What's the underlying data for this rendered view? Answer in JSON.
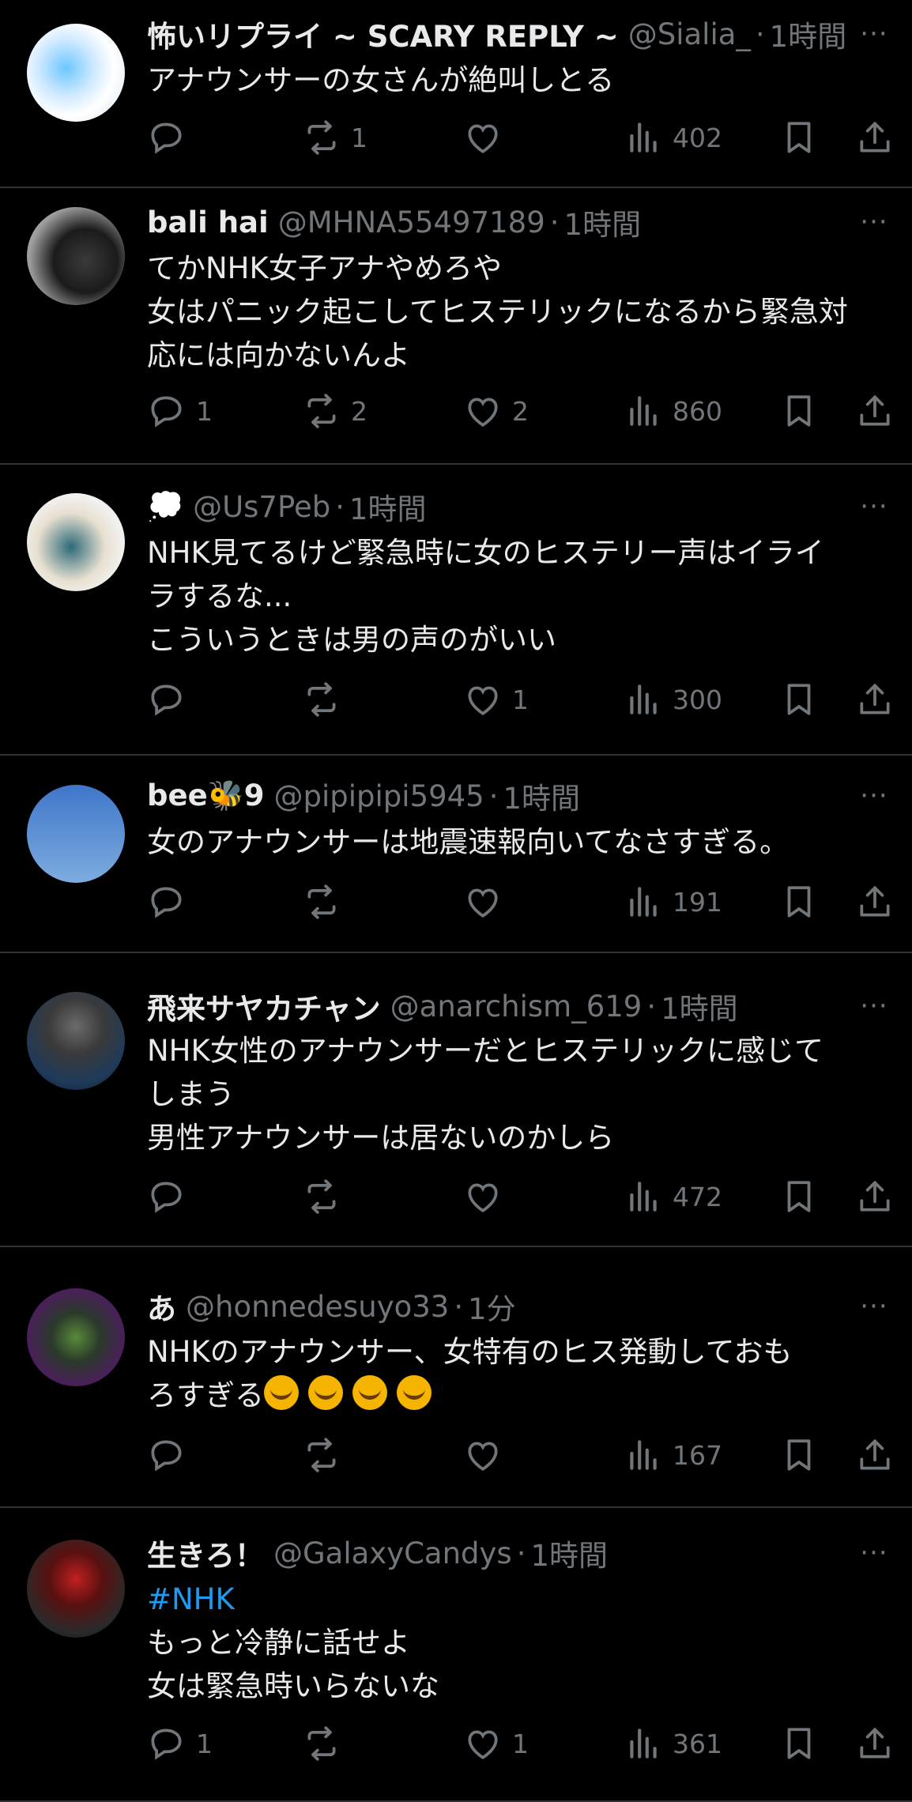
{
  "tweets": [
    {
      "name": "怖いリプライ ~ SCARY REPLY ~",
      "handle": "@Sialia_",
      "time": "1時間",
      "lines": [
        "アナウンサーの女さんが絶叫しとる"
      ],
      "replies": "",
      "retweets": "1",
      "likes": "",
      "views": "402"
    },
    {
      "name": "bali hai",
      "handle": "@MHNA55497189",
      "time": "1時間",
      "lines": [
        "てかNHK女子アナやめろや",
        "女はパニック起こしてヒステリックになるから緊急対",
        "応には向かないんよ"
      ],
      "replies": "1",
      "retweets": "2",
      "likes": "2",
      "views": "860"
    },
    {
      "name": "💭",
      "handle": "@Us7Peb",
      "time": "1時間",
      "lines": [
        "NHK見てるけど緊急時に女のヒステリー声はイライ",
        "ラするな...",
        "こういうときは男の声のがいい"
      ],
      "replies": "",
      "retweets": "",
      "likes": "1",
      "views": "300"
    },
    {
      "name": "bee🐝9",
      "handle": "@pipipipi5945",
      "time": "1時間",
      "lines": [
        "女のアナウンサーは地震速報向いてなさすぎる。"
      ],
      "replies": "",
      "retweets": "",
      "likes": "",
      "views": "191"
    },
    {
      "name": "飛来サヤカチャン",
      "handle": "@anarchism_619",
      "time": "1時間",
      "lines": [
        "NHK女性のアナウンサーだとヒステリックに感じて",
        "しまう",
        "男性アナウンサーは居ないのかしら"
      ],
      "replies": "",
      "retweets": "",
      "likes": "",
      "views": "472"
    },
    {
      "name": "あ",
      "handle": "@honnedesuyo33",
      "time": "1分",
      "lines": [
        "NHKのアナウンサー、女特有のヒス発動しておも",
        "ろすぎる"
      ],
      "emoji_count": 4,
      "replies": "",
      "retweets": "",
      "likes": "",
      "views": "167"
    },
    {
      "name": "生きろ！",
      "handle": "@GalaxyCandys",
      "time": "1時間",
      "hashtag": "#NHK",
      "lines": [
        "もっと冷静に話せよ",
        "女は緊急時いらないな"
      ],
      "replies": "1",
      "retweets": "",
      "likes": "1",
      "views": "361"
    }
  ],
  "ui": {
    "more_label": "···",
    "dot": "·"
  },
  "colors": {
    "background": "#000000",
    "text": "#e7e9ea",
    "muted": "#71767b",
    "divider": "#2f3336",
    "link": "#1d9bf0"
  },
  "icons": [
    "reply-icon",
    "retweet-icon",
    "like-icon",
    "views-icon",
    "bookmark-icon",
    "share-icon",
    "more-icon"
  ]
}
